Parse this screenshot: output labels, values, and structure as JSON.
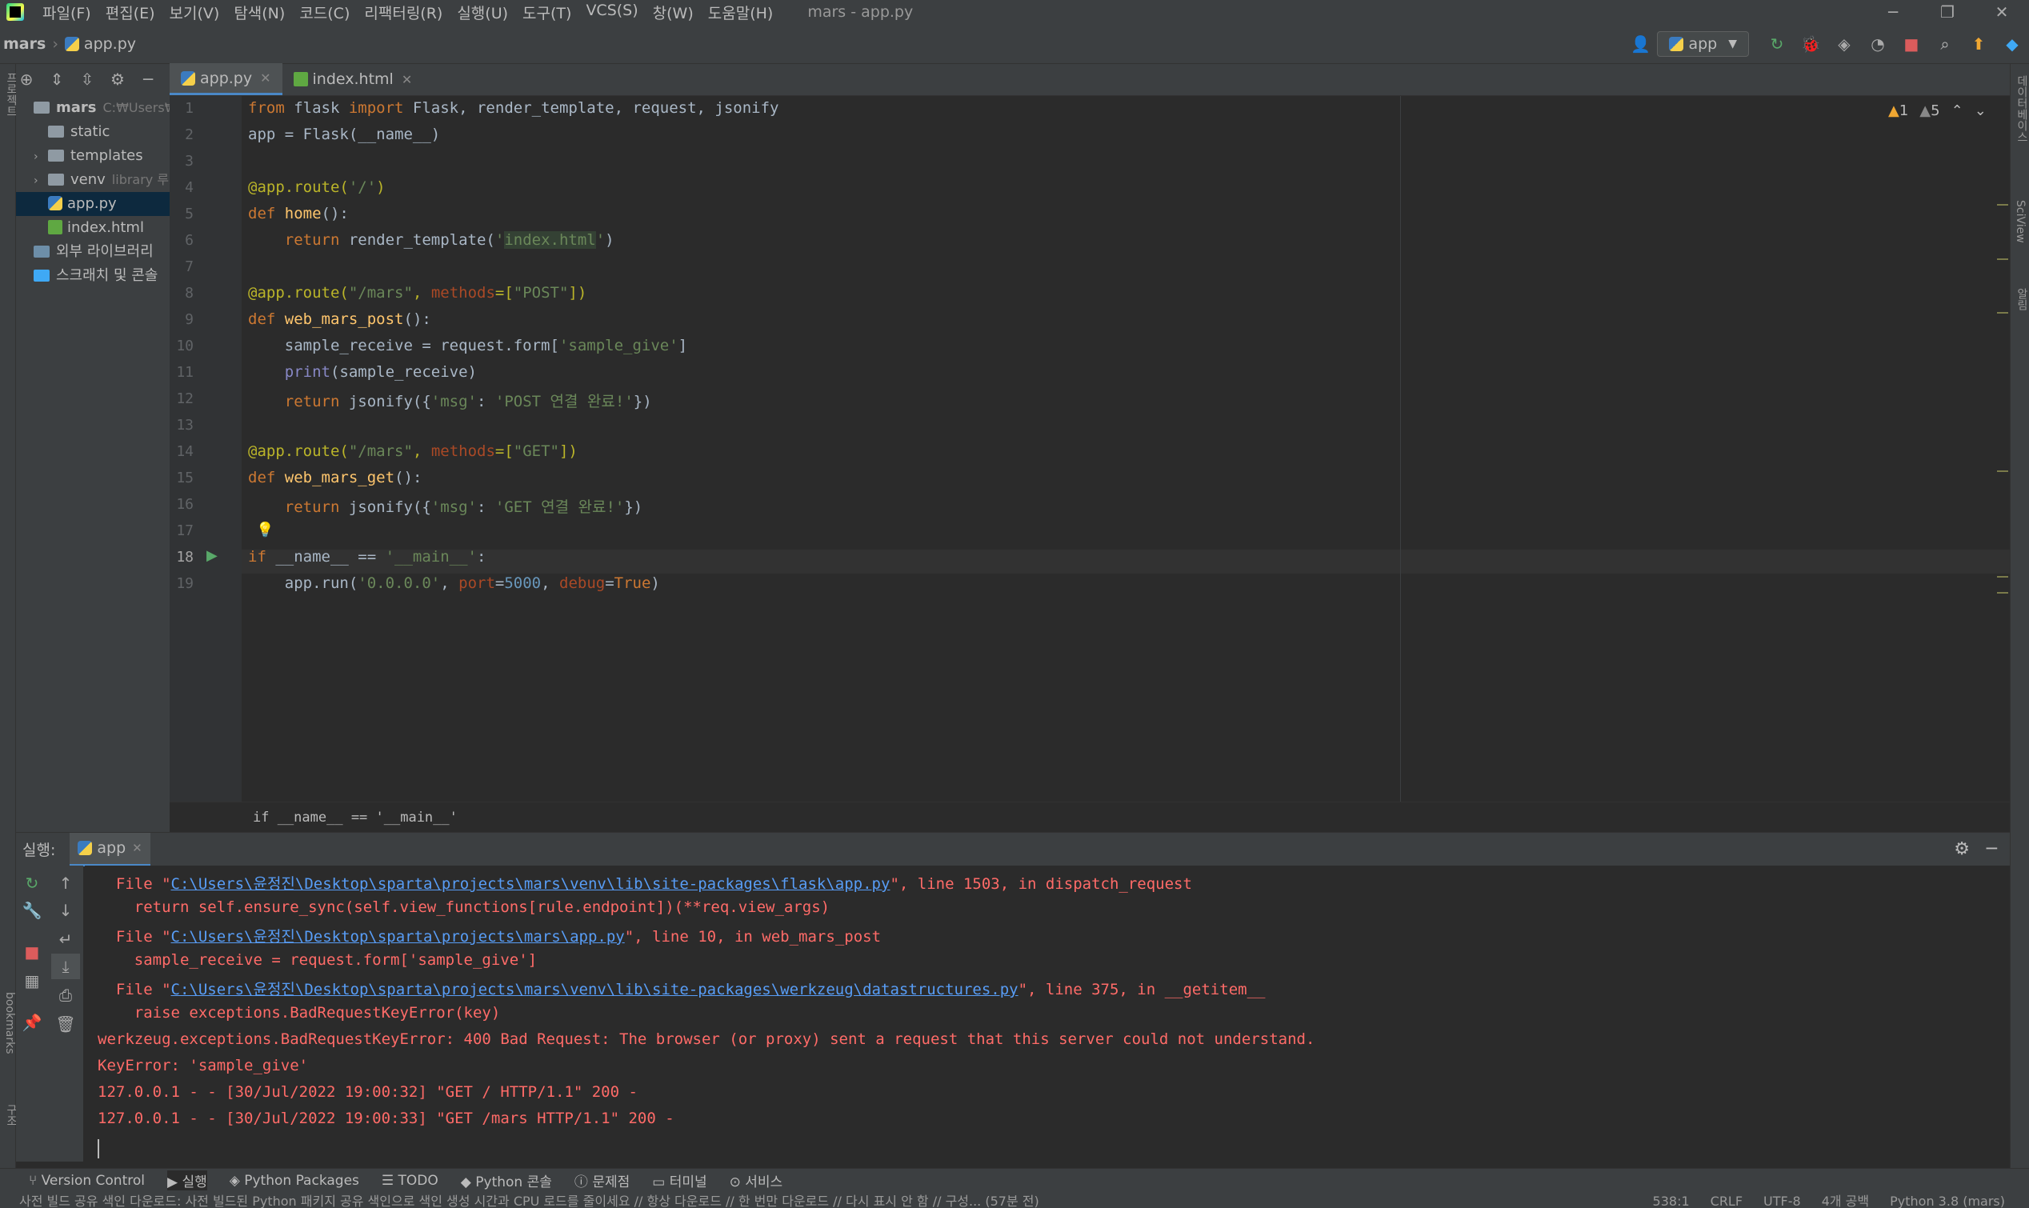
{
  "menu": [
    "파일(F)",
    "편집(E)",
    "보기(V)",
    "탐색(N)",
    "코드(C)",
    "리팩터링(R)",
    "실행(U)",
    "도구(T)",
    "VCS(S)",
    "창(W)",
    "도움말(H)"
  ],
  "window_title": "mars - app.py",
  "breadcrumb": {
    "project": "mars",
    "file": "app.py"
  },
  "run_config": "app",
  "project_tree": [
    {
      "label": "mars",
      "hint": "C:₩Users₩윤",
      "type": "folder",
      "indent": 0
    },
    {
      "label": "static",
      "hint": "",
      "type": "folder",
      "indent": 1
    },
    {
      "label": "templates",
      "hint": "",
      "type": "folder",
      "indent": 1,
      "arrow": "›"
    },
    {
      "label": "venv",
      "hint": "library 루트",
      "type": "folder",
      "indent": 1,
      "arrow": "›"
    },
    {
      "label": "app.py",
      "hint": "",
      "type": "py",
      "indent": 1,
      "selected": true
    },
    {
      "label": "index.html",
      "hint": "",
      "type": "html",
      "indent": 1
    },
    {
      "label": "외부 라이브러리",
      "hint": "",
      "type": "lib",
      "indent": 0
    },
    {
      "label": "스크래치 및 콘솔",
      "hint": "",
      "type": "scratch",
      "indent": 0
    }
  ],
  "tabs": [
    {
      "label": "app.py",
      "active": true
    },
    {
      "label": "index.html",
      "active": false
    }
  ],
  "inspections": {
    "errors": "1",
    "warnings": "5"
  },
  "line_numbers": [
    "1",
    "2",
    "3",
    "4",
    "5",
    "6",
    "7",
    "8",
    "9",
    "10",
    "11",
    "12",
    "13",
    "14",
    "15",
    "16",
    "17",
    "18",
    "19"
  ],
  "editor_breadcrumb": "if __name__ == '__main__'",
  "run_panel": {
    "label": "실행:",
    "tab": "app"
  },
  "console_lines": [
    {
      "pre": "  File \"",
      "link": "C:\\Users\\윤정진\\Desktop\\sparta\\projects\\mars\\venv\\lib\\site-packages\\flask\\app.py",
      "post": "\", line 1503, in dispatch_request"
    },
    {
      "pre": "    return self.ensure_sync(self.view_functions[rule.endpoint])(**req.view_args)",
      "link": "",
      "post": ""
    },
    {
      "pre": "  File \"",
      "link": "C:\\Users\\윤정진\\Desktop\\sparta\\projects\\mars\\app.py",
      "post": "\", line 10, in web_mars_post"
    },
    {
      "pre": "    sample_receive = request.form['sample_give']",
      "link": "",
      "post": ""
    },
    {
      "pre": "  File \"",
      "link": "C:\\Users\\윤정진\\Desktop\\sparta\\projects\\mars\\venv\\lib\\site-packages\\werkzeug\\datastructures.py",
      "post": "\", line 375, in __getitem__"
    },
    {
      "pre": "    raise exceptions.BadRequestKeyError(key)",
      "link": "",
      "post": ""
    },
    {
      "pre": "werkzeug.exceptions.BadRequestKeyError: 400 Bad Request: The browser (or proxy) sent a request that this server could not understand.",
      "link": "",
      "post": ""
    },
    {
      "pre": "KeyError: 'sample_give'",
      "link": "",
      "post": ""
    },
    {
      "pre": "127.0.0.1 - - [30/Jul/2022 19:00:32] \"GET / HTTP/1.1\" 200 -",
      "link": "",
      "post": ""
    },
    {
      "pre": "127.0.0.1 - - [30/Jul/2022 19:00:33] \"GET /mars HTTP/1.1\" 200 -",
      "link": "",
      "post": ""
    }
  ],
  "bottom_tools": [
    "Version Control",
    "실행",
    "Python Packages",
    "TODO",
    "Python 콘솔",
    "문제점",
    "터미널",
    "서비스"
  ],
  "status": {
    "message": "사전 빌드 공유 색인 다운로드: 사전 빌드된 Python 패키지 공유 색인으로 색인 생성 시간과 CPU 로드를 줄이세요 // 항상 다운로드 // 한 번만 다운로드 // 다시 표시 안 함 // 구성... (57분 전)",
    "position": "538:1",
    "line_sep": "CRLF",
    "encoding": "UTF-8",
    "indent": "4개 공백",
    "interpreter": "Python 3.8 (mars)"
  },
  "side_labels": {
    "left_top": "프로젝트",
    "left_bottom": "bookmarks",
    "left_structure": "구조",
    "right_top": "데이터베이스",
    "right_mid": "SciView",
    "right_bottom": "알림"
  }
}
